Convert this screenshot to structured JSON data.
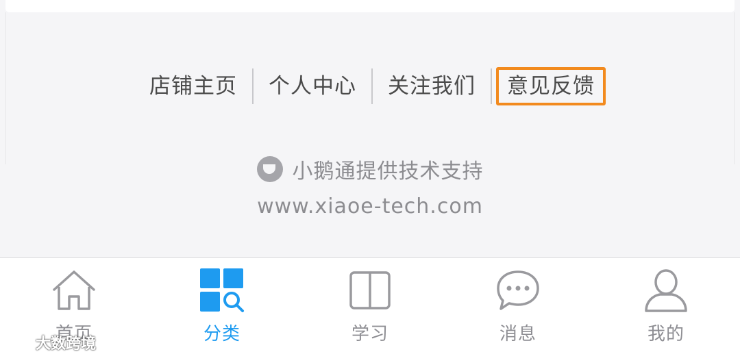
{
  "footer_links": [
    {
      "label": "店铺主页"
    },
    {
      "label": "个人中心"
    },
    {
      "label": "关注我们"
    },
    {
      "label": "意见反馈"
    }
  ],
  "support": {
    "text": "小鹅通提供技术支持",
    "website": "www.xiaoe-tech.com",
    "icon": "xiaoe-logo-icon"
  },
  "tabbar": {
    "tabs": [
      {
        "label": "首页",
        "icon": "home-icon",
        "active": false
      },
      {
        "label": "分类",
        "icon": "category-grid-icon",
        "active": true
      },
      {
        "label": "学习",
        "icon": "book-icon",
        "active": false
      },
      {
        "label": "消息",
        "icon": "chat-bubble-icon",
        "active": false
      },
      {
        "label": "我的",
        "icon": "user-icon",
        "active": false
      }
    ]
  },
  "watermark": {
    "text": "大数跨境"
  },
  "colors": {
    "accent": "#1e9bf0",
    "highlight_border": "#f28a1e",
    "inactive": "#8e8e93",
    "background": "#f5f5f7"
  }
}
